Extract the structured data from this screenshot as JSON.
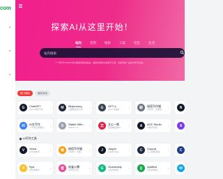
{
  "app": {
    "logo_text": "com"
  },
  "hero": {
    "title": "探索AI从这里开始！",
    "tabs": [
      "站内",
      "常用",
      "搜索",
      "工具",
      "社区",
      "生活"
    ],
    "active_tab": 0,
    "search_placeholder": "站内搜索",
    "tagline": "一个学习ChatGPT及AI相关知识的站点，提供丰富的AI资源与工具，为您开启一站式AI学习之旅。"
  },
  "filters": [
    {
      "label": "热门网站",
      "active": true
    },
    {
      "label": "最新收录",
      "active": false
    }
  ],
  "section": {
    "title": "AI写作工具"
  },
  "cards": [
    {
      "name": "ChatGPT",
      "desc": "OpenAI旗下的...",
      "color": "#111827",
      "glyph": "G"
    },
    {
      "name": "Midjourney",
      "desc": "AI图像生成工具...",
      "color": "#1f2937",
      "glyph": "M"
    },
    {
      "name": "GPT-4",
      "desc": "OpenAI最新...",
      "color": "#374151",
      "glyph": "G"
    },
    {
      "name": "秘塔写作猫",
      "desc": "AI写作，文章自...",
      "color": "#6b7280",
      "glyph": "秘"
    },
    {
      "name": "",
      "desc": "",
      "color": "#111827",
      "glyph": "N"
    },
    {
      "name": "AI文写作",
      "desc": "一字写出流畅文...",
      "color": "#3b82f6",
      "glyph": "AI"
    },
    {
      "name": "Stable Diffu...",
      "desc": "Stability AI...",
      "color": "#9ca3af",
      "glyph": "S"
    },
    {
      "name": "文心一格",
      "desc": "百度推出的AI...",
      "color": "#e11d48",
      "glyph": "文"
    },
    {
      "name": "ACE Studio",
      "desc": "AI歌声合成...",
      "color": "#111827",
      "glyph": "A"
    },
    {
      "name": "",
      "desc": "",
      "color": "#7c3aed",
      "glyph": "A"
    },
    {
      "name": "Versa",
      "desc": "AI写作助手...",
      "color": "#111827",
      "glyph": "V"
    },
    {
      "name": "秘塔写作猫",
      "desc": "AI写作，文章...",
      "color": "#f59e0b",
      "glyph": "秘"
    },
    {
      "name": "Jasper",
      "desc": "AI写作平台...",
      "color": "#111827",
      "glyph": "J"
    },
    {
      "name": "Copy.ai",
      "desc": "人工智能营销...",
      "color": "#1e293b",
      "glyph": "C"
    },
    {
      "name": "",
      "desc": "",
      "color": "#1e3a8a",
      "glyph": "C"
    },
    {
      "name": "Rytr",
      "desc": "AI写作助手...",
      "color": "#fbbf24",
      "glyph": "R"
    },
    {
      "name": "宙雀火爆",
      "desc": "AI写作平台...",
      "color": "#ec4899",
      "glyph": "宙"
    },
    {
      "name": "Grammarly",
      "desc": "AI写作检查...",
      "color": "#10b981",
      "glyph": "G"
    },
    {
      "name": "QuillBot",
      "desc": "AI写作润色...",
      "color": "#16a34a",
      "glyph": "Q"
    },
    {
      "name": "",
      "desc": "",
      "color": "#0ea5e9",
      "glyph": "W"
    }
  ]
}
